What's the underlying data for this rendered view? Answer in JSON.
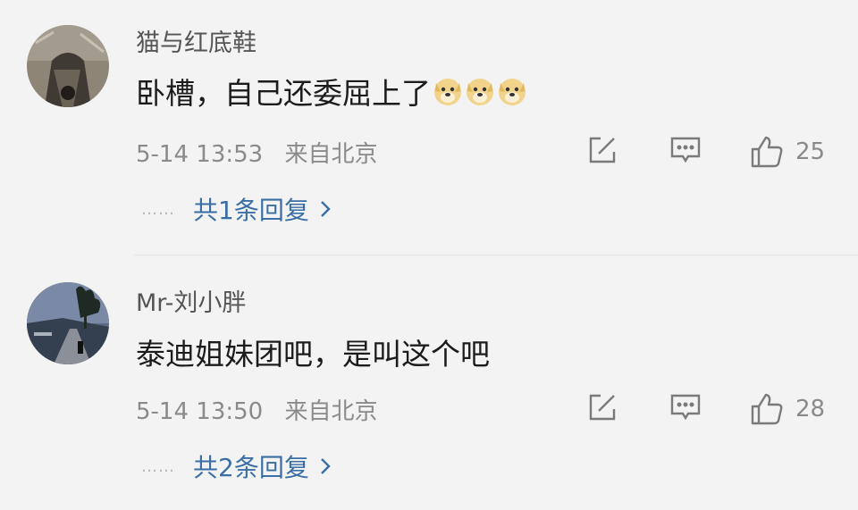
{
  "comments": [
    {
      "username": "猫与红底鞋",
      "text": "卧槽，自己还委屈上了",
      "emojis": [
        "doge-emoji",
        "doge-emoji",
        "doge-emoji"
      ],
      "date": "5-14 13:53",
      "location": "来自北京",
      "likes": "25",
      "replies": "共1条回复",
      "dots": "……",
      "icons": {
        "edit": "share-edit-icon",
        "comment": "comment-icon",
        "like": "thumbs-up-icon",
        "chevron": "chevron-right-icon"
      }
    },
    {
      "username": "Mr-刘小胖",
      "text": "泰迪姐妹团吧，是叫这个吧",
      "emojis": [],
      "date": "5-14 13:50",
      "location": "来自北京",
      "likes": "28",
      "replies": "共2条回复",
      "dots": "……",
      "icons": {
        "edit": "share-edit-icon",
        "comment": "comment-icon",
        "like": "thumbs-up-icon",
        "chevron": "chevron-right-icon"
      }
    }
  ],
  "colors": {
    "background": "#f3f3f3",
    "reply_link": "#3a6ea5",
    "meta": "#8a8a8a",
    "icon": "#7a7a7a"
  }
}
